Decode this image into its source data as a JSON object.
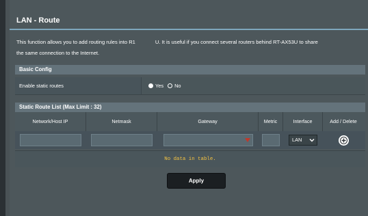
{
  "page": {
    "title": "LAN - Route",
    "description_part1": "This function allows you to add routing rules into R1",
    "description_part2": "U. It is useful if you connect several routers behind RT-AX53U to share",
    "description_line2": "the same connection to the Internet."
  },
  "basic_config": {
    "header": "Basic Config",
    "enable_label": "Enable static routes",
    "yes_label": "Yes",
    "no_label": "No",
    "selected": "Yes"
  },
  "route_list": {
    "header": "Static Route List (Max Limit : 32)",
    "columns": [
      "Network/Host IP",
      "Netmask",
      "Gateway",
      "Metric",
      "Interface",
      "Add / Delete"
    ],
    "inputs": {
      "network_value": "",
      "netmask_value": "",
      "gateway_value": "",
      "metric_value": "",
      "interface_value": "LAN"
    },
    "empty_message": "No data in table."
  },
  "actions": {
    "apply_label": "Apply"
  },
  "colors": {
    "accent": "#7ea7bd",
    "empty_text": "#f5c342",
    "dropdown_arrow": "#c0392b"
  },
  "icons": {
    "add": "add-circle-icon",
    "gateway_dropdown": "dropdown-arrow-icon",
    "interface_chevron": "chevron-down-icon"
  }
}
